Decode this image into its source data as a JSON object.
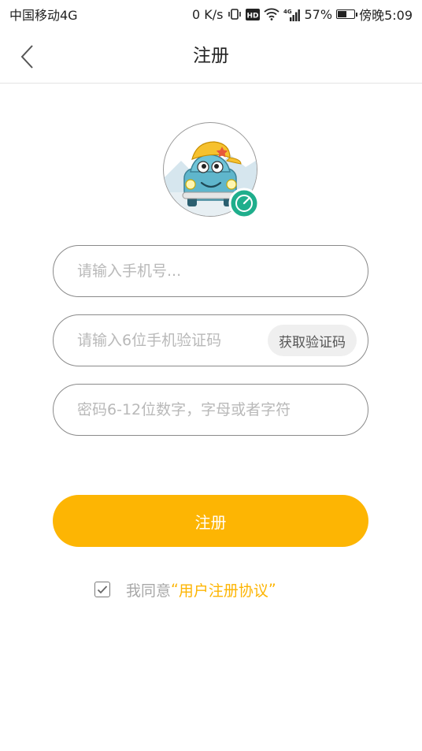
{
  "status_bar": {
    "carrier": "中国移动4G",
    "speed": "0 K/s",
    "hd": "HD",
    "network": "4G",
    "battery": "57%",
    "battery_level": 0.57,
    "time": "傍晚5:09"
  },
  "nav": {
    "title": "注册"
  },
  "form": {
    "phone_placeholder": "请输入手机号...",
    "code_placeholder": "请输入6位手机验证码",
    "get_code_label": "获取验证码",
    "password_placeholder": "密码6-12位数字，字母或者字符"
  },
  "register_button": "注册",
  "agreement": {
    "prefix": "我同意",
    "open_quote": "“",
    "link": "用户注册协议",
    "close_quote": "”",
    "checked": true
  },
  "colors": {
    "accent": "#fdb503",
    "badge": "#1fae8c"
  }
}
